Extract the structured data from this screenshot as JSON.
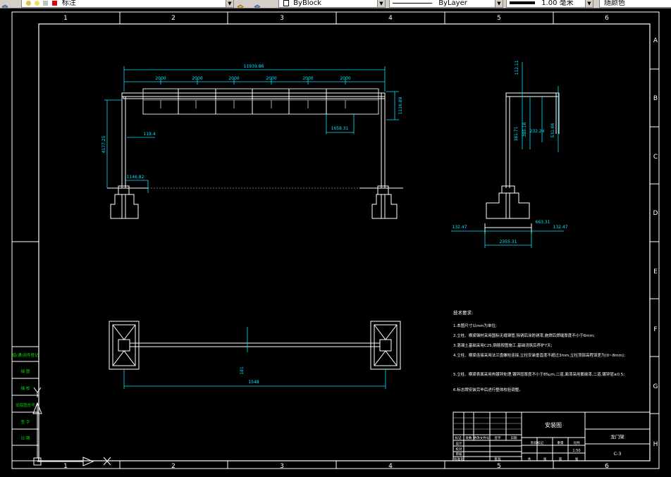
{
  "toolbar": {
    "layer_name": "标注",
    "color": "ByBlock",
    "linetype": "ByLayer",
    "lineweight": "1.00 毫米",
    "plot_style": "随颜色"
  },
  "grid": {
    "cols": [
      "1",
      "2",
      "3",
      "4",
      "5",
      "6"
    ],
    "rows": [
      "A",
      "B",
      "C",
      "D",
      "E",
      "F",
      "G",
      "H"
    ]
  },
  "dims": {
    "overall_width": "11939.86",
    "seg1": "2000",
    "seg2": "2000",
    "seg3": "2000",
    "seg4": "2000",
    "seg5": "2000",
    "seg6": "2000",
    "beam_height": "1116.89",
    "overhang": "1658.31",
    "col_height": "4177.25",
    "col_offset": "119.4",
    "base_offset": "1146.82",
    "top_offset": "112.11",
    "arm_a": "381.71",
    "arm_b": "385.18",
    "arm_c": "232.24",
    "arm_d": "531.66",
    "base_left": "132.47",
    "base_right_a": "663.31",
    "base_right_b": "132.47",
    "base_width": "2355.31",
    "plan_gap": "181",
    "plan_span": "1548"
  },
  "notes": {
    "title": "技术要求:",
    "lines": [
      "1.本图尺寸以mm为单位;",
      "2.立柱、横梁钢材采用国标无缝钢管,除锈后涂防锈漆,施焊后焊缝厚度不小于6mm;",
      "3.混凝土基础采用C25,钢筋按图施工,基础浇筑后养护7天;",
      "4.立柱、横梁连接采用法兰盘螺栓连接,立柱安装垂直度不超过3mm,立柱顶部高程误差为(0~8mm);",
      "5.立柱、横梁表面采用热镀锌处理,镀锌层厚度不小于85μm,二道,面漆采用氟碳漆,二道,镀锌层≥0.5;",
      "6.标志牌安装完毕后进行整体校验调整。"
    ]
  },
  "left_strip": [
    "借(通)用件登记",
    "描 图",
    "描 校",
    "旧底图总号",
    "签 字",
    "日 期"
  ],
  "title_block": {
    "drawing_name": "安装图",
    "project": "龙门架",
    "sheet": "1:50",
    "code": "C-3",
    "labels": [
      "标记",
      "处数",
      "更改文件号",
      "签字",
      "日期",
      "设计",
      "校对",
      "审核",
      "标准化",
      "批准",
      "阶段标记",
      "重量",
      "比例",
      "共",
      "张",
      "第",
      "张"
    ]
  }
}
